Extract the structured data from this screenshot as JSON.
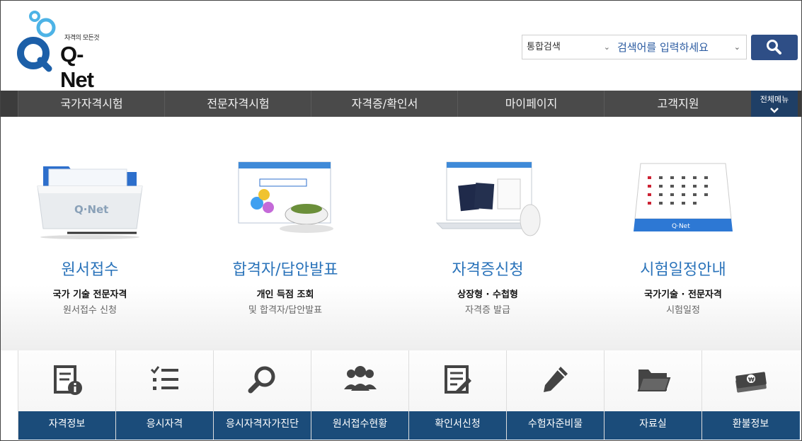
{
  "header": {
    "logo_tagline": "자격의 모든것",
    "logo_text": "Q-Net"
  },
  "search": {
    "scope": "통합검색",
    "placeholder": "검색어를 입력하세요"
  },
  "nav": {
    "items": [
      "국가자격시험",
      "전문자격시험",
      "자격증/확인서",
      "마이페이지",
      "고객지원"
    ],
    "all_menu_label": "전체메뉴"
  },
  "features": [
    {
      "title": "원서접수",
      "line1": "국가 기술 전문자격",
      "line2": "원서접수 신청"
    },
    {
      "title": "합격자/답안발표",
      "line1": "개인 득점 조회",
      "line2": "및 합격자/답안발표"
    },
    {
      "title": "자격증신청",
      "line1": "상장형 · 수첩형",
      "line2": "자격증 발급"
    },
    {
      "title": "시험일정안내",
      "line1": "국가기술 · 전문자격",
      "line2": "시험일정"
    }
  ],
  "quick_links": [
    {
      "label": "자격정보",
      "icon": "info-document-icon"
    },
    {
      "label": "응시자격",
      "icon": "checklist-icon"
    },
    {
      "label": "응시자격자가진단",
      "icon": "magnifier-icon"
    },
    {
      "label": "원서접수현황",
      "icon": "people-icon"
    },
    {
      "label": "확인서신청",
      "icon": "document-edit-icon"
    },
    {
      "label": "수험자준비물",
      "icon": "pencil-icon"
    },
    {
      "label": "자료실",
      "icon": "folder-icon"
    },
    {
      "label": "환불정보",
      "icon": "money-icon"
    }
  ],
  "colors": {
    "accent_blue": "#2a73ba",
    "nav_bg": "#4a4a4a",
    "all_menu_bg": "#1f3f66",
    "quick_label_bg": "#1b4c7a",
    "search_button_bg": "#2e4e86"
  }
}
